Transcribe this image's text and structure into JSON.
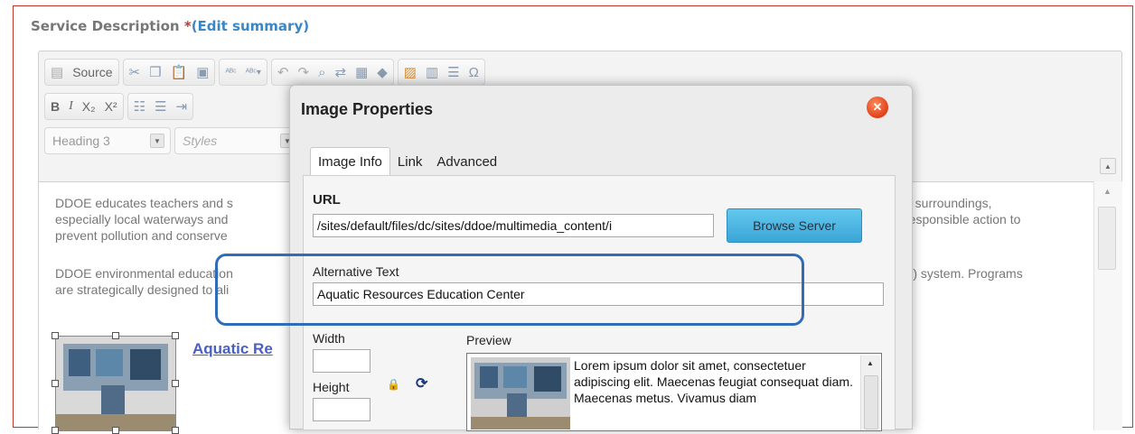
{
  "section": {
    "title": "Service Description ",
    "required": "*",
    "edit_link": "(Edit summary)"
  },
  "toolbar": {
    "source_label": "Source",
    "bold": "B",
    "italic": "I",
    "subscript": "X₂",
    "superscript": "X²",
    "format_value": "Heading 3",
    "styles_placeholder": "Styles"
  },
  "content": {
    "para1_line1": "DDOE educates teachers and s",
    "para1_line2": "especially local waterways and",
    "para1_line3": "prevent pollution and conserve",
    "para1_right1": "ir surroundings,",
    "para1_right2": "responsible action to",
    "para2_line1": "DDOE environmental education",
    "para2_line2": "are strategically designed to ali",
    "para2_right1": "S) system. Programs",
    "link_text": "Aquatic Re"
  },
  "dialog": {
    "title": "Image Properties",
    "tabs": [
      "Image Info",
      "Link",
      "Advanced"
    ],
    "url_label": "URL",
    "url_value": "/sites/default/files/dc/sites/ddoe/multimedia_content/i",
    "browse_label": "Browse Server",
    "alt_label": "Alternative Text",
    "alt_value": "Aquatic Resources Education Center",
    "width_label": "Width",
    "height_label": "Height",
    "preview_label": "Preview",
    "preview_text": "Lorem ipsum dolor sit amet, consectetuer adipiscing elit. Maecenas feugiat consequat diam. Maecenas metus. Vivamus diam"
  },
  "colors": {
    "frame_border": "#c0392b",
    "highlight": "#2f6db8",
    "browse_button": "#3aa5d6",
    "link": "#4a5fc1"
  }
}
